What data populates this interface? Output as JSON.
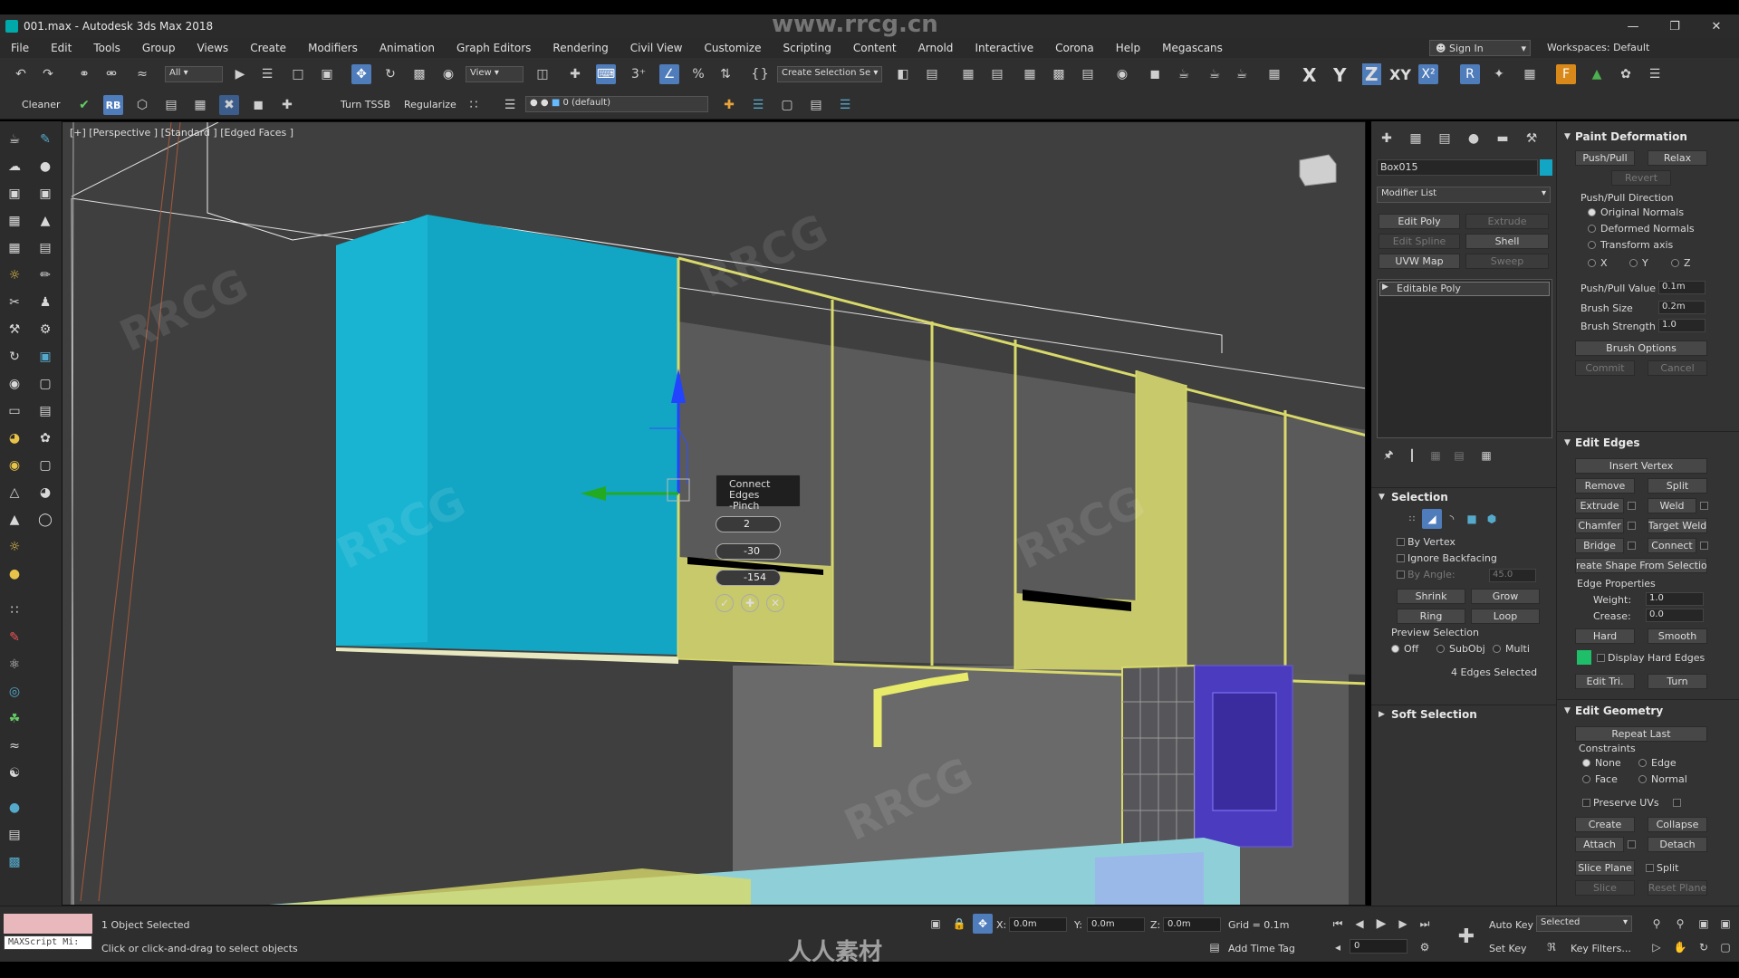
{
  "title": "001.max - Autodesk 3ds Max 2018",
  "watermark_top": "www.rrcg.cn",
  "menu": [
    "File",
    "Edit",
    "Tools",
    "Group",
    "Views",
    "Create",
    "Modifiers",
    "Animation",
    "Graph Editors",
    "Rendering",
    "Civil View",
    "Customize",
    "Scripting",
    "Content",
    "Arnold",
    "Interactive",
    "Corona",
    "Help",
    "Megascans"
  ],
  "signin": "Sign In",
  "workspaces_label": "Workspaces:",
  "workspaces_value": "Default",
  "toolbar": {
    "filter": "All",
    "view": "View",
    "create_selection": "Create Selection Se",
    "axes": [
      "X",
      "Y",
      "Z",
      "XY"
    ],
    "cleaner": "Cleaner",
    "turn_tssb": "Turn TSSB",
    "regularize": "Regularize",
    "layer": "0 (default)"
  },
  "viewport": {
    "label": "[+] [Perspective ] [Standard ] [Edged Faces ]",
    "caddy_title": "Connect Edges",
    "caddy_sub": "-Pinch",
    "segments": "2",
    "pinch": "-30",
    "slide": "-154"
  },
  "command_panel": {
    "object_name": "Box015",
    "modifier_list": "Modifier List",
    "buttons": [
      "Edit Poly",
      "Extrude",
      "Edit Spline",
      "Shell",
      "UVW Map",
      "Sweep"
    ],
    "stack_item": "Editable Poly",
    "selection_header": "Selection",
    "by_vertex": "By Vertex",
    "ignore_backfacing": "Ignore Backfacing",
    "by_angle": "By Angle:",
    "by_angle_value": "45.0",
    "shrink": "Shrink",
    "grow": "Grow",
    "ring": "Ring",
    "loop": "Loop",
    "preview_selection": "Preview Selection",
    "preview_options": [
      "Off",
      "SubObj",
      "Multi"
    ],
    "edges_selected": "4 Edges Selected",
    "soft_selection": "Soft Selection"
  },
  "roll_panel": {
    "paint_deformation": "Paint Deformation",
    "push_pull": "Push/Pull",
    "relax": "Relax",
    "revert": "Revert",
    "push_pull_direction": "Push/Pull Direction",
    "direction_options": [
      "Original Normals",
      "Deformed Normals",
      "Transform axis"
    ],
    "axis_options": [
      "X",
      "Y",
      "Z"
    ],
    "push_pull_value_label": "Push/Pull Value",
    "push_pull_value": "0.1m",
    "brush_size_label": "Brush Size",
    "brush_size": "0.2m",
    "brush_strength_label": "Brush Strength",
    "brush_strength": "1.0",
    "brush_options": "Brush Options",
    "commit": "Commit",
    "cancel": "Cancel",
    "edit_edges": "Edit Edges",
    "insert_vertex": "Insert Vertex",
    "remove": "Remove",
    "split": "Split",
    "extrude": "Extrude",
    "weld": "Weld",
    "chamfer": "Chamfer",
    "target_weld": "Target Weld",
    "bridge": "Bridge",
    "connect": "Connect",
    "create_shape": "Create Shape From Selection",
    "edge_properties": "Edge Properties",
    "weight_label": "Weight:",
    "weight": "1.0",
    "crease_label": "Crease:",
    "crease": "0.0",
    "hard": "Hard",
    "smooth": "Smooth",
    "display_hard_edges": "Display Hard Edges",
    "edit_tri": "Edit Tri.",
    "turn": "Turn",
    "edit_geometry": "Edit Geometry",
    "repeat_last": "Repeat Last",
    "constraints": "Constraints",
    "constraint_options": [
      "None",
      "Edge",
      "Face",
      "Normal"
    ],
    "preserve_uvs": "Preserve UVs",
    "create": "Create",
    "collapse": "Collapse",
    "attach": "Attach",
    "detach": "Detach",
    "slice_plane": "Slice Plane",
    "split2": "Split",
    "slice": "Slice",
    "reset_plane": "Reset Plane"
  },
  "status": {
    "maxscript": "MAXScript Mi:",
    "selected": "1 Object Selected",
    "prompt": "Click or click-and-drag to select objects",
    "x_label": "X:",
    "x": "0.0m",
    "y_label": "Y:",
    "y": "0.0m",
    "z_label": "Z:",
    "z": "0.0m",
    "grid": "Grid = 0.1m",
    "add_time_tag": "Add Time Tag",
    "auto_key": "Auto Key",
    "selected_dd": "Selected",
    "set_key": "Set Key",
    "key_filters": "Key Filters...",
    "frame": "0",
    "brand": "人人素材"
  },
  "colors": {
    "accent": "#4f7cba",
    "cyan": "#12a6c4",
    "yellow": "#d8d96a",
    "purple": "#4a3bbf"
  }
}
